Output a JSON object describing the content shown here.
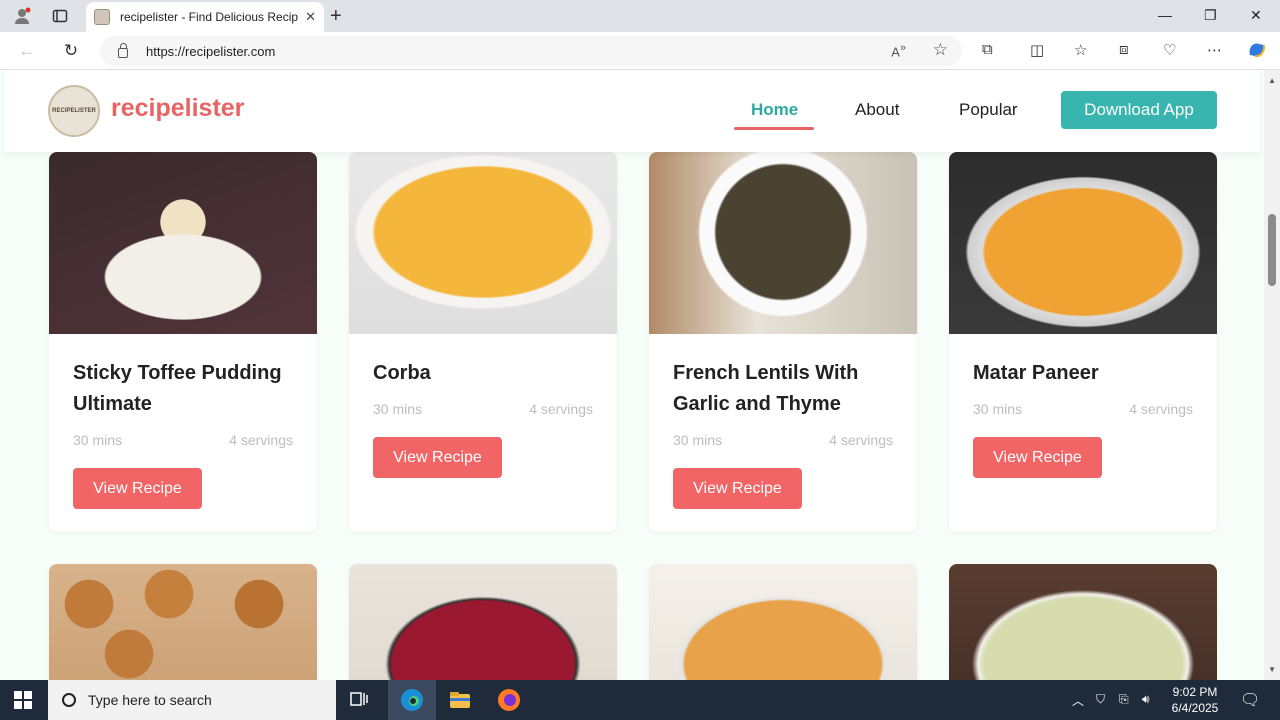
{
  "browser": {
    "tab_title": "recipelister - Find Delicious Recip",
    "url": "https://recipelister.com",
    "window_controls": {
      "minimize": "—",
      "restore": "❐",
      "close": "✕"
    }
  },
  "site": {
    "brand": "recipelister",
    "logo_text": "RECIPELISTER",
    "nav": [
      {
        "label": "Home",
        "active": true
      },
      {
        "label": "About",
        "active": false
      },
      {
        "label": "Popular",
        "active": false
      }
    ],
    "cta_label": "Download App"
  },
  "recipes": [
    {
      "name": "Sticky Toffee Pudding Ultimate",
      "time": "30 mins",
      "servings": "4 servings",
      "button": "View Recipe"
    },
    {
      "name": "Corba",
      "time": "30 mins",
      "servings": "4 servings",
      "button": "View Recipe"
    },
    {
      "name": "French Lentils With Garlic and Thyme",
      "time": "30 mins",
      "servings": "4 servings",
      "button": "View Recipe"
    },
    {
      "name": "Matar Paneer",
      "time": "30 mins",
      "servings": "4 servings",
      "button": "View Recipe"
    }
  ],
  "taskbar": {
    "search_placeholder": "Type here to search",
    "time": "9:02 PM",
    "date": "6/4/2025"
  },
  "colors": {
    "brand": "#e86464",
    "teal": "#37b5ae",
    "button": "#f16566"
  }
}
